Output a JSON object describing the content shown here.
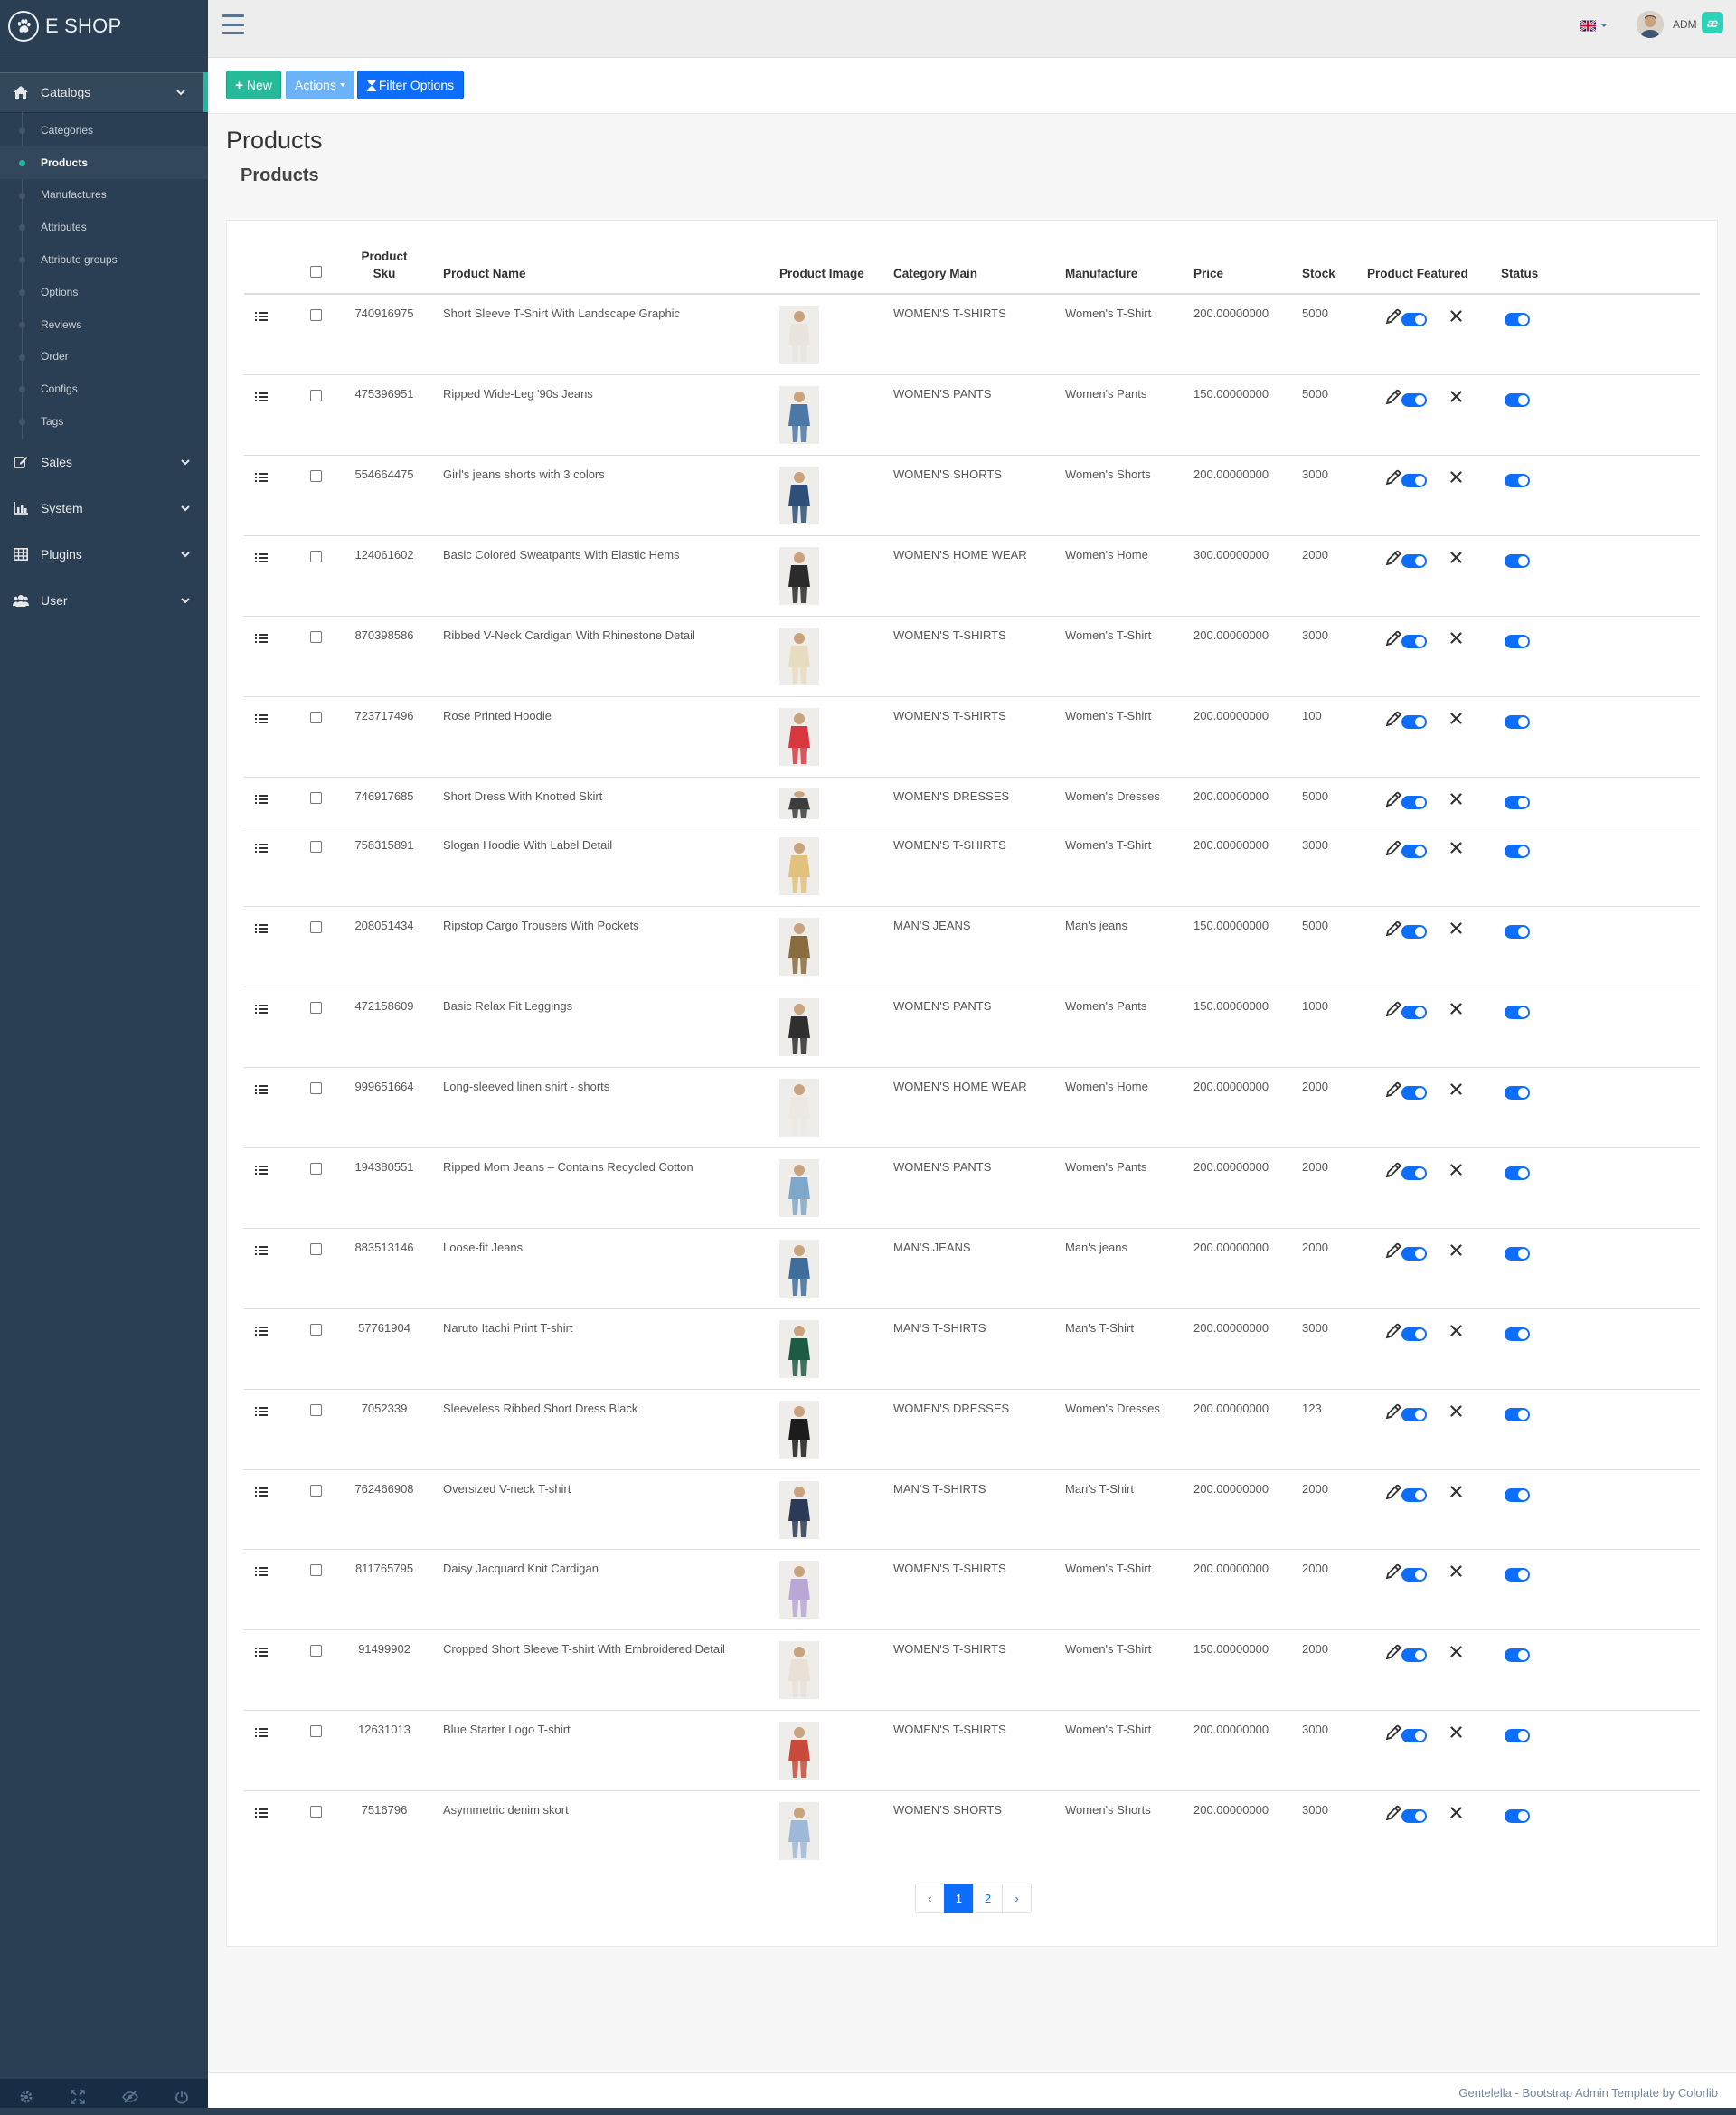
{
  "brand": {
    "name": "E SHOP"
  },
  "sidebar": {
    "sections": [
      {
        "label": "Catalogs",
        "icon": "home-icon"
      },
      {
        "label": "Sales",
        "icon": "edit-icon"
      },
      {
        "label": "System",
        "icon": "bar-chart-icon"
      },
      {
        "label": "Plugins",
        "icon": "table-icon"
      },
      {
        "label": "User",
        "icon": "users-icon"
      }
    ],
    "catalog_items": [
      "Categories",
      "Products",
      "Manufactures",
      "Attributes",
      "Attribute groups",
      "Options",
      "Reviews",
      "Order",
      "Configs",
      "Tags"
    ],
    "active_item": "Products"
  },
  "topnav": {
    "user_name": "ADM",
    "user_badge": "æ"
  },
  "toolbar": {
    "new_label": "New",
    "actions_label": "Actions",
    "filter_label": "Filter Options"
  },
  "page": {
    "title": "Products",
    "subtitle": "Products"
  },
  "table": {
    "headers": {
      "sku_line1": "Product",
      "sku_line2": "Sku",
      "name": "Product Name",
      "image": "Product Image",
      "category": "Category Main",
      "manufacture": "Manufacture",
      "price": "Price",
      "stock": "Stock",
      "featured": "Product Featured",
      "status": "Status"
    },
    "rows": [
      {
        "sku": "740916975",
        "name": "Short Sleeve T-Shirt With Landscape Graphic",
        "category": "WOMEN'S T-SHIRTS",
        "manufacture": "Women's T-Shirt",
        "price": "200.00000000",
        "stock": "5000",
        "featured": true,
        "status": true
      },
      {
        "sku": "475396951",
        "name": "Ripped Wide-Leg '90s Jeans",
        "category": "WOMEN'S PANTS",
        "manufacture": "Women's Pants",
        "price": "150.00000000",
        "stock": "5000",
        "featured": true,
        "status": true
      },
      {
        "sku": "554664475",
        "name": "Girl's jeans shorts with 3 colors",
        "category": "WOMEN'S SHORTS",
        "manufacture": "Women's Shorts",
        "price": "200.00000000",
        "stock": "3000",
        "featured": true,
        "status": true
      },
      {
        "sku": "124061602",
        "name": "Basic Colored Sweatpants With Elastic Hems",
        "category": "WOMEN'S HOME WEAR",
        "manufacture": "Women's Home",
        "price": "300.00000000",
        "stock": "2000",
        "featured": true,
        "status": true
      },
      {
        "sku": "870398586",
        "name": "Ribbed V-Neck Cardigan With Rhinestone Detail",
        "category": "WOMEN'S T-SHIRTS",
        "manufacture": "Women's T-Shirt",
        "price": "200.00000000",
        "stock": "3000",
        "featured": true,
        "status": true
      },
      {
        "sku": "723717496",
        "name": "Rose Printed Hoodie",
        "category": "WOMEN'S T-SHIRTS",
        "manufacture": "Women's T-Shirt",
        "price": "200.00000000",
        "stock": "100",
        "featured": true,
        "status": true
      },
      {
        "sku": "746917685",
        "name": "Short Dress With Knotted Skirt",
        "category": "WOMEN'S DRESSES",
        "manufacture": "Women's Dresses",
        "price": "200.00000000",
        "stock": "5000",
        "featured": true,
        "status": true
      },
      {
        "sku": "758315891",
        "name": "Slogan Hoodie With Label Detail",
        "category": "WOMEN'S T-SHIRTS",
        "manufacture": "Women's T-Shirt",
        "price": "200.00000000",
        "stock": "3000",
        "featured": true,
        "status": true
      },
      {
        "sku": "208051434",
        "name": "Ripstop Cargo Trousers With Pockets",
        "category": "MAN'S JEANS",
        "manufacture": "Man's jeans",
        "price": "150.00000000",
        "stock": "5000",
        "featured": true,
        "status": true
      },
      {
        "sku": "472158609",
        "name": "Basic Relax Fit Leggings",
        "category": "WOMEN'S PANTS",
        "manufacture": "Women's Pants",
        "price": "150.00000000",
        "stock": "1000",
        "featured": true,
        "status": true
      },
      {
        "sku": "999651664",
        "name": "Long-sleeved linen shirt - shorts",
        "category": "WOMEN'S HOME WEAR",
        "manufacture": "Women's Home",
        "price": "200.00000000",
        "stock": "2000",
        "featured": true,
        "status": true
      },
      {
        "sku": "194380551",
        "name": "Ripped Mom Jeans – Contains Recycled Cotton",
        "category": "WOMEN'S PANTS",
        "manufacture": "Women's Pants",
        "price": "200.00000000",
        "stock": "2000",
        "featured": true,
        "status": true
      },
      {
        "sku": "883513146",
        "name": "Loose-fit Jeans",
        "category": "MAN'S JEANS",
        "manufacture": "Man's jeans",
        "price": "200.00000000",
        "stock": "2000",
        "featured": true,
        "status": true
      },
      {
        "sku": "57761904",
        "name": "Naruto Itachi Print T-shirt",
        "category": "MAN'S T-SHIRTS",
        "manufacture": "Man's T-Shirt",
        "price": "200.00000000",
        "stock": "3000",
        "featured": true,
        "status": true
      },
      {
        "sku": "7052339",
        "name": "Sleeveless Ribbed Short Dress Black",
        "category": "WOMEN'S DRESSES",
        "manufacture": "Women's Dresses",
        "price": "200.00000000",
        "stock": "123",
        "featured": true,
        "status": true
      },
      {
        "sku": "762466908",
        "name": "Oversized V-neck T-shirt",
        "category": "MAN'S T-SHIRTS",
        "manufacture": "Man's T-Shirt",
        "price": "200.00000000",
        "stock": "2000",
        "featured": true,
        "status": true
      },
      {
        "sku": "811765795",
        "name": "Daisy Jacquard Knit Cardigan",
        "category": "WOMEN'S T-SHIRTS",
        "manufacture": "Women's T-Shirt",
        "price": "200.00000000",
        "stock": "2000",
        "featured": true,
        "status": true
      },
      {
        "sku": "91499902",
        "name": "Cropped Short Sleeve T-shirt With Embroidered Detail",
        "category": "WOMEN'S T-SHIRTS",
        "manufacture": "Women's T-Shirt",
        "price": "150.00000000",
        "stock": "2000",
        "featured": true,
        "status": true
      },
      {
        "sku": "12631013",
        "name": "Blue Starter Logo T-shirt",
        "category": "WOMEN'S T-SHIRTS",
        "manufacture": "Women's T-Shirt",
        "price": "200.00000000",
        "stock": "3000",
        "featured": true,
        "status": true
      },
      {
        "sku": "7516796",
        "name": "Asymmetric denim skort",
        "category": "WOMEN'S SHORTS",
        "manufacture": "Women's Shorts",
        "price": "200.00000000",
        "stock": "3000",
        "featured": true,
        "status": true
      }
    ]
  },
  "pagination": {
    "prev": "‹",
    "pages": [
      "1",
      "2"
    ],
    "current": "1",
    "next": "›"
  },
  "footer": {
    "text": "Gentelella - Bootstrap Admin Template by Colorlib"
  },
  "colors": {
    "sidebar": "#2A3F54",
    "accent": "#1ABB9C",
    "primary": "#0D6EFD",
    "success": "#26B99A"
  }
}
